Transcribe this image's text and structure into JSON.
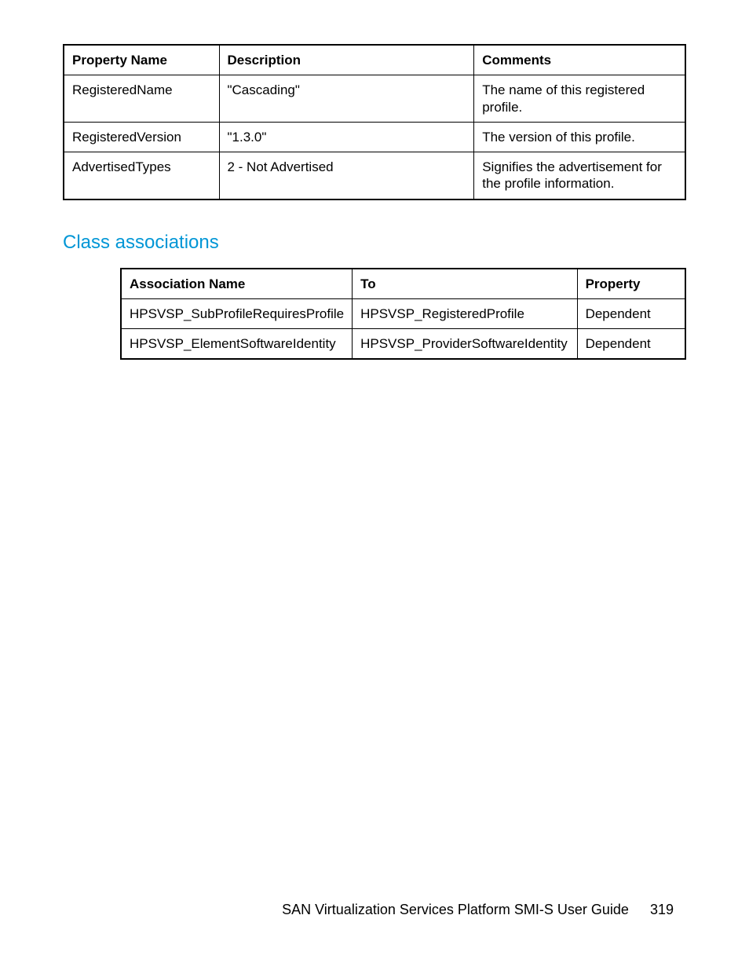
{
  "table1": {
    "headers": [
      "Property Name",
      "Description",
      "Comments"
    ],
    "rows": [
      {
        "c0": "RegisteredName",
        "c1": "\"Cascading\"",
        "c2": "The name of this registered profile."
      },
      {
        "c0": "RegisteredVersion",
        "c1": "\"1.3.0\"",
        "c2": "The version of this profile."
      },
      {
        "c0": "AdvertisedTypes",
        "c1": "2 - Not Advertised",
        "c2": "Signifies the advertisement for the profile information."
      }
    ]
  },
  "section_heading": "Class associations",
  "table2": {
    "headers": [
      "Association Name",
      "To",
      "Property"
    ],
    "rows": [
      {
        "c0": "HPSVSP_SubProfileRequiresProfile",
        "c1": "HPSVSP_RegisteredProfile",
        "c2": "Dependent"
      },
      {
        "c0": "HPSVSP_ElementSoftwareIdentity",
        "c1": "HPSVSP_ProviderSoftwareIdentity",
        "c2": "Dependent"
      }
    ]
  },
  "footer": {
    "title": "SAN Virtualization Services Platform SMI-S User Guide",
    "page": "319"
  }
}
